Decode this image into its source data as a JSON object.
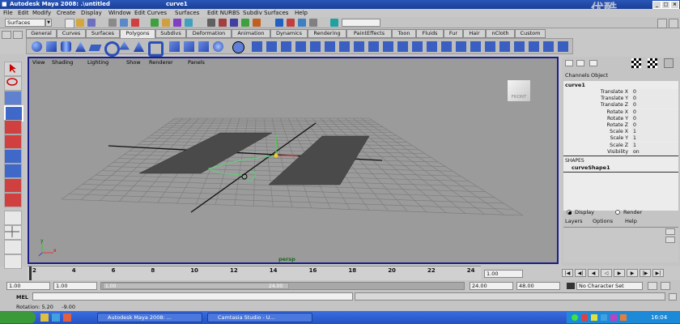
{
  "window": {
    "title": "Autodesk Maya 2008: .\\untitled",
    "object": "curve1",
    "watermark": "优酷"
  },
  "menu": [
    "File",
    "Edit",
    "Modify",
    "Create",
    "Display",
    "Window",
    "Edit Curves",
    "Surfaces",
    "Edit NURBS",
    "Subdiv Surfaces",
    "Help"
  ],
  "status": {
    "mode_select": "Surfaces"
  },
  "shelf_tabs": [
    "General",
    "Curves",
    "Surfaces",
    "Polygons",
    "Subdivs",
    "Deformation",
    "Animation",
    "Dynamics",
    "Rendering",
    "PaintEffects",
    "Toon",
    "Fluids",
    "Fur",
    "Hair",
    "nCloth",
    "Custom"
  ],
  "shelf_active": "Polygons",
  "viewport": {
    "menu": [
      "View",
      "Shading",
      "Lighting",
      "Show",
      "Renderer",
      "Panels"
    ],
    "camera_label": "persp",
    "viewcube_label": "FRONT",
    "axis_x": "x",
    "axis_y": "y"
  },
  "channel_box": {
    "header": [
      "Channels",
      "Object"
    ],
    "object_name": "curve1",
    "attributes": [
      {
        "name": "Translate X",
        "value": "0"
      },
      {
        "name": "Translate Y",
        "value": "0"
      },
      {
        "name": "Translate Z",
        "value": "0"
      },
      {
        "name": "Rotate X",
        "value": "0"
      },
      {
        "name": "Rotate Y",
        "value": "0"
      },
      {
        "name": "Rotate Z",
        "value": "0"
      },
      {
        "name": "Scale X",
        "value": "1"
      },
      {
        "name": "Scale Y",
        "value": "1"
      },
      {
        "name": "Scale Z",
        "value": "1"
      },
      {
        "name": "Visibility",
        "value": "on"
      }
    ],
    "shapes_label": "SHAPES",
    "shape_name": "curveShape1",
    "layer_modes": [
      "Display",
      "Render"
    ],
    "layer_menu": [
      "Layers",
      "Options",
      "Help"
    ]
  },
  "time_slider": {
    "ticks": [
      "2",
      "4",
      "6",
      "8",
      "10",
      "12",
      "14",
      "16",
      "18",
      "20",
      "22",
      "24"
    ],
    "current_frame": "1.00"
  },
  "range_slider": {
    "start": "1.00",
    "playback_start": "1.00",
    "range_start_label": "1.00",
    "range_end_label": "24.00",
    "playback_end": "24.00",
    "end": "48.00",
    "character_set": "No Character Set"
  },
  "command_line": {
    "label": "MEL"
  },
  "help_line": {
    "text": "Rotation: 5.20     -9.00"
  },
  "taskbar": {
    "buttons": [
      "Autodesk Maya 2008: ...",
      "Camtasia Studio - U..."
    ],
    "clock": "16:04"
  }
}
